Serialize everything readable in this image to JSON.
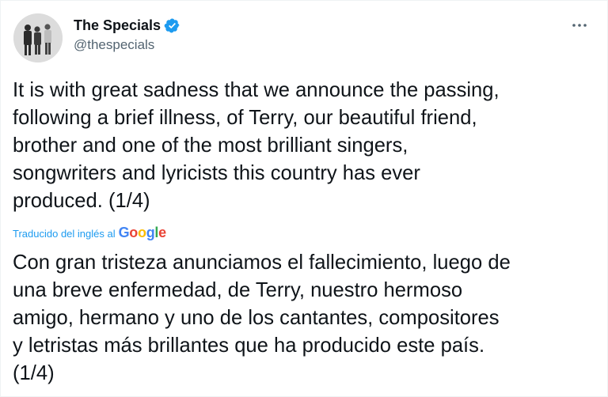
{
  "author": {
    "display_name": "The Specials",
    "handle": "@thespecials",
    "verified_icon": "verified-badge-icon",
    "avatar_icon": "avatar-photo"
  },
  "menu": {
    "icon": "more-options-icon"
  },
  "tweet": {
    "text": "It is with great sadness that we announce the passing,\nfollowing a brief illness, of Terry, our beautiful friend,\nbrother and one of the most brilliant singers,\nsongwriters and lyricists this country has ever\nproduced. (1/4)"
  },
  "translation": {
    "label": "Traducido del inglés al",
    "provider_letters": [
      "G",
      "o",
      "o",
      "g",
      "l",
      "e"
    ],
    "text": "Con gran tristeza anunciamos el fallecimiento, luego de\nuna breve enfermedad, de Terry, nuestro hermoso\namigo, hermano y uno de los cantantes, compositores\ny letristas más brillantes que ha producido este país.\n(1/4)"
  },
  "colors": {
    "text": "#0f1419",
    "secondary": "#536471",
    "accent": "#1d9bf0"
  }
}
